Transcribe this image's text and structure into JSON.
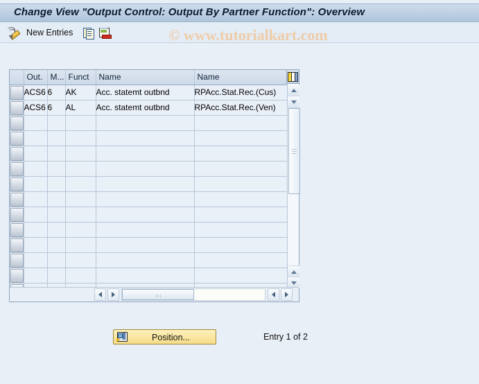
{
  "window": {
    "title": "Change View \"Output Control: Output By Partner Function\": Overview"
  },
  "watermark": {
    "text": "© www.tutorialkart.com"
  },
  "toolbar": {
    "edit_icon": "pencil-icon",
    "new_entries_label": "New Entries",
    "copy_icon": "copy-icon",
    "delete_icon": "document-delete-icon"
  },
  "table": {
    "config_icon": "column-config-icon",
    "columns": [
      {
        "key": "out",
        "label": "Out."
      },
      {
        "key": "medium",
        "label": "M..."
      },
      {
        "key": "funct",
        "label": "Funct"
      },
      {
        "key": "name1",
        "label": "Name"
      },
      {
        "key": "name2",
        "label": "Name"
      }
    ],
    "rows": [
      {
        "out": "ACS6",
        "medium": "6",
        "funct": "AK",
        "name1": "Acc. statemt outbnd",
        "name2": "RPAcc.Stat.Rec.(Cus)"
      },
      {
        "out": "ACS6",
        "medium": "6",
        "funct": "AL",
        "name1": "Acc. statemt outbnd",
        "name2": "RPAcc.Stat.Rec.(Ven)"
      }
    ],
    "empty_row_count": 12,
    "scroll": {
      "up_arrow": "triangle-up-icon",
      "down_arrow": "triangle-down-icon",
      "left_arrow": "triangle-left-icon",
      "right_arrow": "triangle-right-icon"
    }
  },
  "footer": {
    "position_button_label": "Position...",
    "position_icon": "position-icon",
    "entry_status": "Entry 1 of 2"
  },
  "colors": {
    "title_bar": "#bed0e4",
    "page_background": "#e9eff6",
    "cell_background": "#eaf0f8",
    "header_background": "#ccd9e8",
    "button_yellow": "#f6dd8a",
    "watermark": "#f0c79a"
  }
}
